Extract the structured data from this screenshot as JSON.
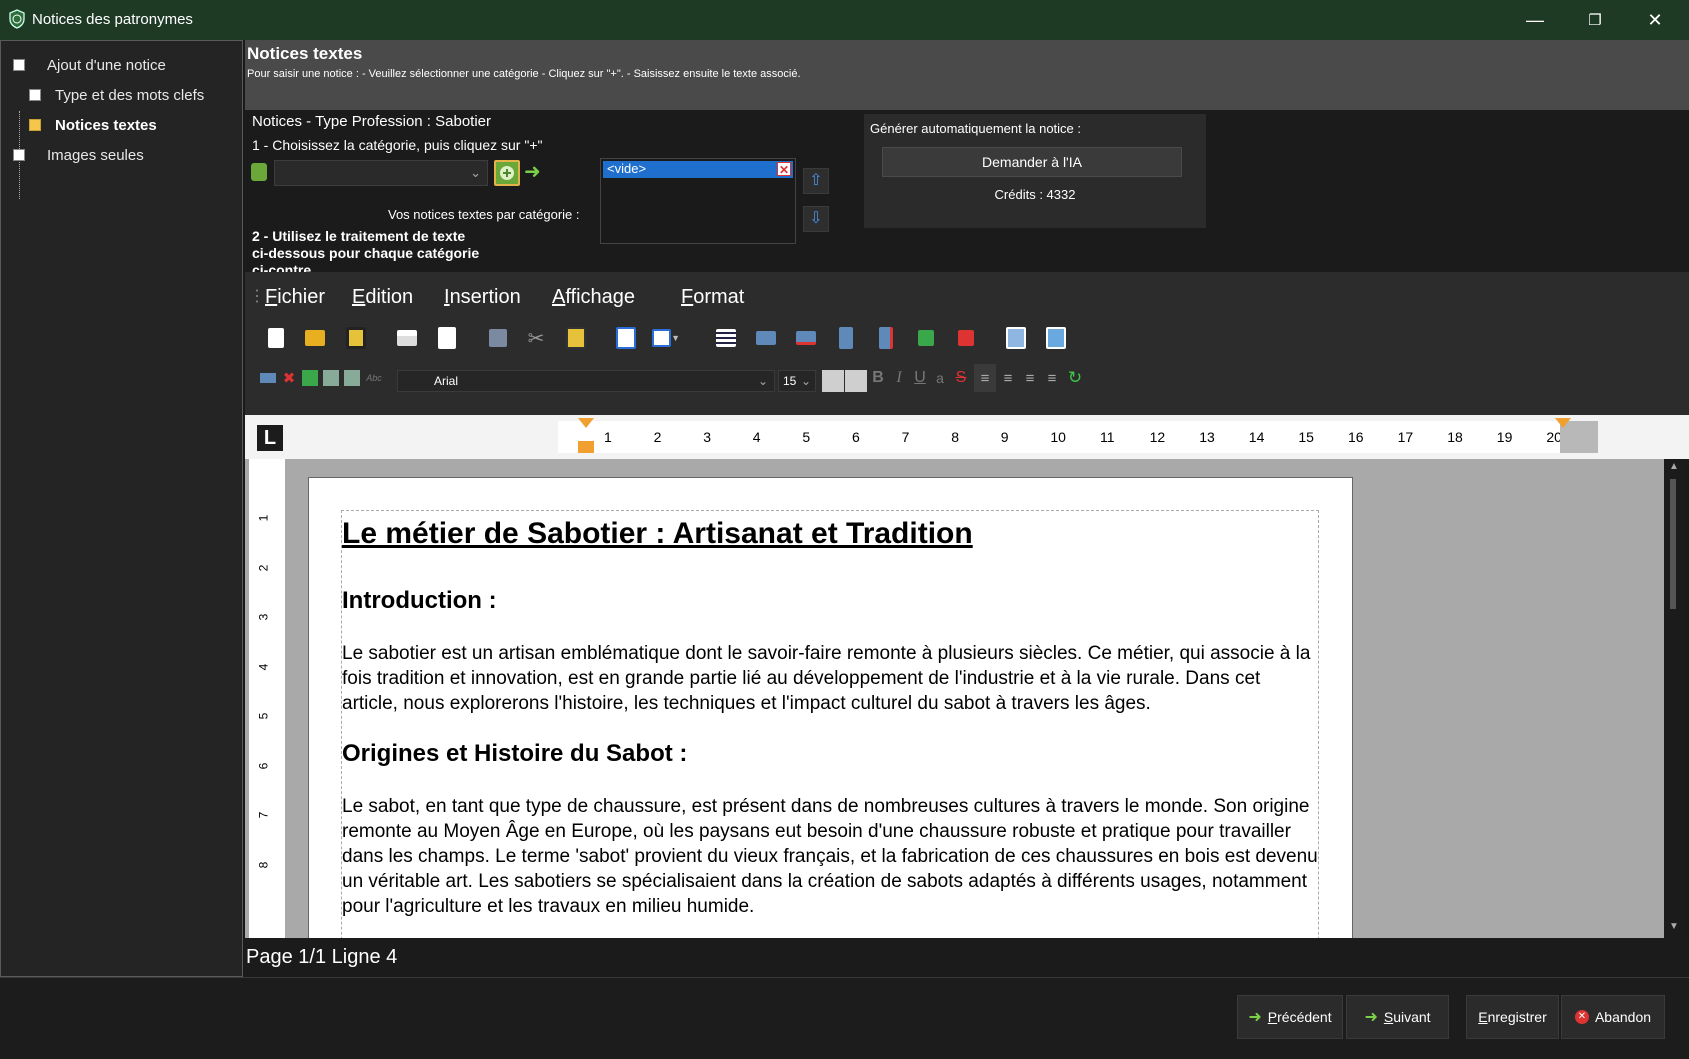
{
  "window": {
    "title": "Notices des patronymes"
  },
  "nav": {
    "items": [
      {
        "label": "Ajout d'une notice"
      },
      {
        "label": "Type et des mots clefs"
      },
      {
        "label": "Notices textes"
      },
      {
        "label": "Images seules"
      }
    ]
  },
  "header": {
    "title": "Notices textes",
    "instructions": "Pour saisir une notice : - Veuillez sélectionner une catégorie - Cliquez sur \"+\". - Saisissez ensuite le texte associé."
  },
  "category_panel": {
    "heading": "Notices - Type Profession : Sabotier",
    "step1": "1 - Choisissez la catégorie, puis cliquez sur \"+\"",
    "combo_value": "",
    "by_category_label": "Vos notices textes par catégorie :",
    "step2_line1": "2 - Utilisez le traitement de texte",
    "step2_line2": "ci-dessous pour chaque catégorie",
    "step2_line3": "ci-contre",
    "list_items": [
      "<vide>"
    ]
  },
  "ai_panel": {
    "label": "Générer automatiquement la notice :",
    "button": "Demander à l'IA",
    "credits": "Crédits : 4332"
  },
  "editor": {
    "menus": [
      {
        "underline": "F",
        "rest": "ichier"
      },
      {
        "underline": "E",
        "rest": "dition"
      },
      {
        "underline": "I",
        "rest": "nsertion"
      },
      {
        "underline": "A",
        "rest": "ffichage"
      },
      {
        "underline": "F",
        "rest": "ormat"
      }
    ],
    "font_name": "Arial",
    "font_size": "15",
    "ruler_labels": [
      "1",
      "2",
      "3",
      "4",
      "5",
      "6",
      "7",
      "8",
      "9",
      "10",
      "11",
      "12",
      "13",
      "14",
      "15",
      "16",
      "17",
      "18",
      "19",
      "20"
    ],
    "vruler_labels": [
      "1",
      "2",
      "3",
      "4",
      "5",
      "6",
      "7",
      "8"
    ],
    "status": "Page 1/1 Ligne 4"
  },
  "document": {
    "title": "Le métier de Sabotier : Artisanat et Tradition",
    "h_intro": "Introduction :",
    "p_intro": "Le sabotier est un artisan emblématique dont le savoir-faire remonte à plusieurs siècles. Ce métier, qui associe à la fois tradition et innovation, est en grande partie lié au développement de l'industrie et à la vie rurale. Dans cet article, nous explorerons l'histoire, les techniques et l'impact culturel du sabot à travers les âges.",
    "h_origins": "Origines et Histoire du Sabot :",
    "p_origins": "Le sabot, en tant que type de chaussure, est présent dans de nombreuses cultures à travers le monde. Son origine remonte au Moyen Âge en Europe, où les paysans eut besoin d'une chaussure robuste et pratique pour travailler dans les champs. Le terme 'sabot' provient du vieux français, et la fabrication de ces chaussures en bois est devenu un véritable art. Les sabotiers se spécialisaient dans la création de sabots adaptés à différents usages, notamment pour l'agriculture et les travaux en milieu humide."
  },
  "footer": {
    "prev_u": "P",
    "prev_rest": "récédent",
    "next_u": "S",
    "next_rest": "uivant",
    "save_u": "E",
    "save_rest": "nregistrer",
    "cancel": "Abandon"
  }
}
